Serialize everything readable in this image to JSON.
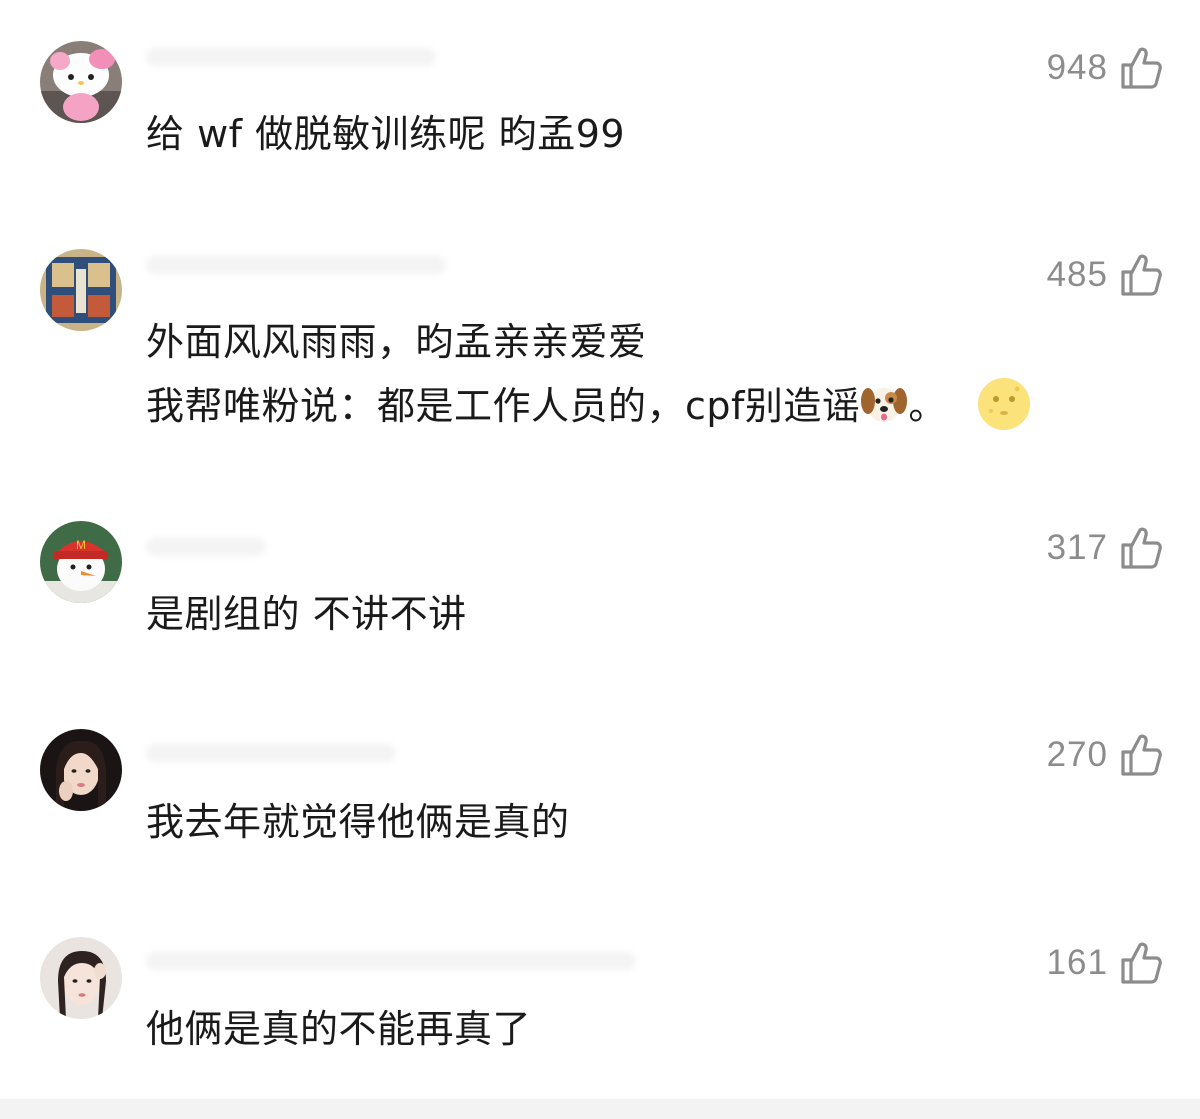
{
  "comments": [
    {
      "text_lines": [
        "给 wf 做脱敏训练呢 昀孟99"
      ],
      "likes": "948"
    },
    {
      "text_lines": [
        "外面风风雨雨，昀孟亲亲爱爱",
        "我帮唯粉说：都是工作人员的，cpf别造谣"
      ],
      "trailing": "。",
      "likes": "485"
    },
    {
      "text_lines": [
        "是剧组的 不讲不讲"
      ],
      "likes": "317"
    },
    {
      "text_lines": [
        "我去年就觉得他俩是真的"
      ],
      "likes": "270"
    },
    {
      "text_lines": [
        "他俩是真的不能再真了"
      ],
      "likes": "161"
    }
  ],
  "icons": {
    "like": "thumbs-up-outline-icon",
    "emoji_dog": "dog-face-emoji",
    "emoji_moon": "full-moon-face-emoji"
  },
  "colors": {
    "text": "#1a1a1a",
    "meta": "#8c8c8c",
    "background": "#ffffff"
  }
}
